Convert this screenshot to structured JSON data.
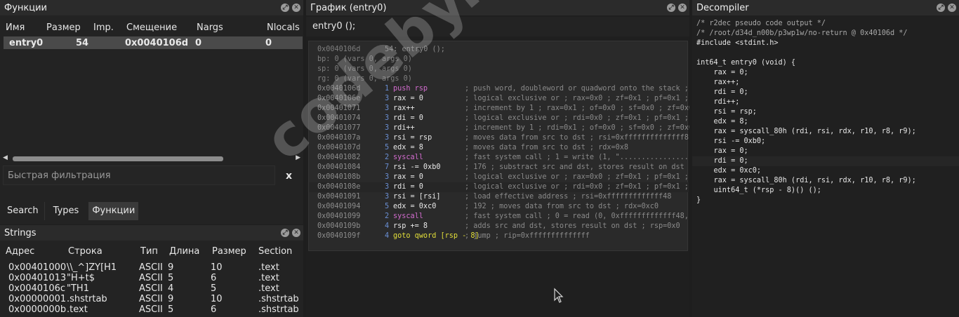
{
  "functions_panel": {
    "title": "Функции",
    "columns": [
      "Имя",
      "Размер",
      "Imp.",
      "Смещение",
      "Nargs",
      "Nlocals"
    ],
    "rows": [
      [
        "entry0",
        "54",
        "",
        "0x0040106d",
        "0",
        "0"
      ]
    ],
    "filter_placeholder": "Быстрая фильтрация",
    "filter_clear": "x",
    "tabs": [
      "Search",
      "Types",
      "Функции"
    ]
  },
  "strings_panel": {
    "title": "Strings",
    "columns": [
      "Адрес",
      "Строка",
      "Тип",
      "Длина",
      "Размер",
      "Section"
    ],
    "rows": [
      [
        "0x00401000",
        "\\\\_^]ZY[H1",
        "ASCII",
        "9",
        "10",
        ".text"
      ],
      [
        "0x00401013",
        "\"H+t$",
        "ASCII",
        "5",
        "6",
        ".text"
      ],
      [
        "0x0040106c",
        "\"TH1",
        "ASCII",
        "4",
        "5",
        ".text"
      ],
      [
        "0x00000001",
        ".shstrtab",
        "ASCII",
        "9",
        "10",
        ".shstrtab"
      ],
      [
        "0x0000000b",
        ".text",
        "ASCII",
        "5",
        "6",
        ".shstrtab"
      ]
    ]
  },
  "graph_panel": {
    "title": "График (entry0)",
    "signature": "entry0 ();",
    "header_lines": [
      {
        "addr": "0x0040106d",
        "rest": "54: entry0 ();"
      },
      {
        "addr": "bp: 0 (vars 0, args 0)",
        "rest": ""
      },
      {
        "addr": "sp: 0 (vars 0, args 0)",
        "rest": ""
      },
      {
        "addr": "rg: 0 (vars 0, args 0)",
        "rest": ""
      }
    ],
    "instructions": [
      {
        "addr": "0x0040106d",
        "size": "1",
        "op": "push rsp",
        "comment": "; push word, doubleword or quadword onto the stack ;"
      },
      {
        "addr": "0x0040106e",
        "size": "3",
        "op": "rax = 0",
        "comment": "; logical exclusive or ; rax=0x0 ; zf=0x1 ; pf=0x1 ;"
      },
      {
        "addr": "0x00401071",
        "size": "3",
        "op": "rax++",
        "comment": "; increment by 1 ; rax=0x1 ; of=0x0 ; sf=0x0 ; zf=0x0"
      },
      {
        "addr": "0x00401074",
        "size": "3",
        "op": "rdi = 0",
        "comment": "; logical exclusive or ; rdi=0x0 ; zf=0x1 ; pf=0x1 ;"
      },
      {
        "addr": "0x00401077",
        "size": "3",
        "op": "rdi++",
        "comment": "; increment by 1 ; rdi=0x1 ; of=0x0 ; sf=0x0 ; zf=0x0"
      },
      {
        "addr": "0x0040107a",
        "size": "3",
        "op": "rsi = rsp",
        "comment": "; moves data from src to dst ; rsi=0xffffffffffffff8"
      },
      {
        "addr": "0x0040107d",
        "size": "5",
        "op": "edx = 8",
        "comment": "; moves data from src to dst ; rdx=0x8"
      },
      {
        "addr": "0x00401082",
        "size": "2",
        "op": "syscall",
        "comment": "; fast system call ; 1 = write (1, \"................"
      },
      {
        "addr": "0x00401084",
        "size": "7",
        "op": "rsi -= 0xb0",
        "comment": "; 176 ; substract src and dst, stores result on dst ;"
      },
      {
        "addr": "0x0040108b",
        "size": "3",
        "op": "rax = 0",
        "comment": "; logical exclusive or ; rax=0x0 ; zf=0x1 ; pf=0x1 ;"
      },
      {
        "addr": "0x0040108e",
        "size": "3",
        "op": "rdi = 0",
        "comment": "; logical exclusive or ; rdi=0x0 ; zf=0x1 ; pf=0x1 ;"
      },
      {
        "addr": "0x00401091",
        "size": "3",
        "op": "rsi = [rsi]",
        "comment": "; load effective address ; rsi=0xfffffffffffff48"
      },
      {
        "addr": "0x00401094",
        "size": "5",
        "op": "edx = 0xc0",
        "comment": "; 192 ; moves data from src to dst ; rdx=0xc0"
      },
      {
        "addr": "0x00401099",
        "size": "2",
        "op": "syscall",
        "comment": "; fast system call ; 0 = read (0, 0xfffffffffffff48,"
      },
      {
        "addr": "0x0040109b",
        "size": "4",
        "op": "rsp += 8",
        "comment": "; adds src and dst, stores result on dst ; rsp=0x0"
      },
      {
        "addr": "0x0040109f",
        "size": "4",
        "op": "goto qword [rsp - 8]",
        "comment": "; jump ; rip=0xffffffffffffff"
      }
    ]
  },
  "decompiler_panel": {
    "title": "Decompiler",
    "lines": [
      "/* r2dec pseudo code output */",
      "/* /root/d34d_n00b/p3wp1w/no-return @ 0x40106d */",
      "#include <stdint.h>",
      "",
      "int64_t entry0 (void) {",
      "    rax = 0;",
      "    rax++;",
      "    rdi = 0;",
      "    rdi++;",
      "    rsi = rsp;",
      "    edx = 8;",
      "    rax = syscall_80h (rdi, rsi, rdx, r10, r8, r9);",
      "    rsi -= 0xb0;",
      "    rax = 0;",
      "    rdi = 0;",
      "    edx = 0xc0;",
      "    rax = syscall_80h (rdi, rsi, rdx, r10, r8, r9);",
      "    uint64_t (*rsp - 8)() ();",
      "}"
    ]
  },
  "watermark": "codeby.net"
}
